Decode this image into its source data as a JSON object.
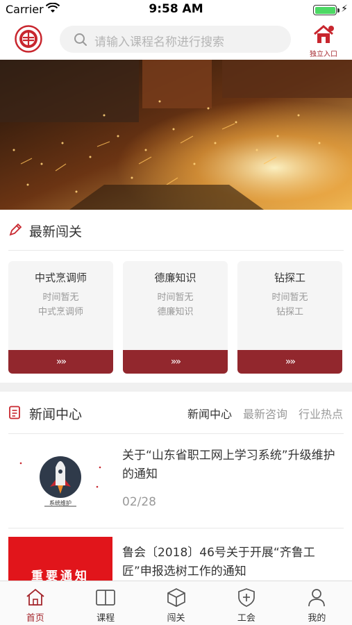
{
  "status": {
    "carrier": "Carrier",
    "time": "9:58 AM"
  },
  "header": {
    "search_placeholder": "请输入课程名称进行搜索",
    "entry_label": "独立入口"
  },
  "latest": {
    "title": "最新闯关",
    "cards": [
      {
        "title": "中式烹调师",
        "time": "时间暂无",
        "sub": "中式烹调师",
        "button": "»»"
      },
      {
        "title": "德廉知识",
        "time": "时间暂无",
        "sub": "德廉知识",
        "button": "»»"
      },
      {
        "title": "钻探工",
        "time": "时间暂无",
        "sub": "钻探工",
        "button": "»»"
      }
    ]
  },
  "news": {
    "title": "新闻中心",
    "tabs": [
      "新闻中心",
      "最新咨询",
      "行业热点"
    ],
    "items": [
      {
        "headline": "关于“山东省职工网上学习系统”升级维护的通知",
        "date": "02/28",
        "thumb_caption": "系统维护"
      },
      {
        "headline": "鲁会〔2018〕46号关于开展“齐鲁工匠”申报选树工作的通知",
        "thumb_caption": "重要通知"
      }
    ]
  },
  "tabbar": [
    {
      "label": "首页",
      "icon": "home-icon",
      "active": true
    },
    {
      "label": "课程",
      "icon": "book-icon",
      "active": false
    },
    {
      "label": "闯关",
      "icon": "cube-icon",
      "active": false
    },
    {
      "label": "工会",
      "icon": "shield-icon",
      "active": false
    },
    {
      "label": "我的",
      "icon": "user-icon",
      "active": false
    }
  ],
  "colors": {
    "accent": "#a4262c",
    "button": "#92272d",
    "background": "#f5f5f5"
  }
}
